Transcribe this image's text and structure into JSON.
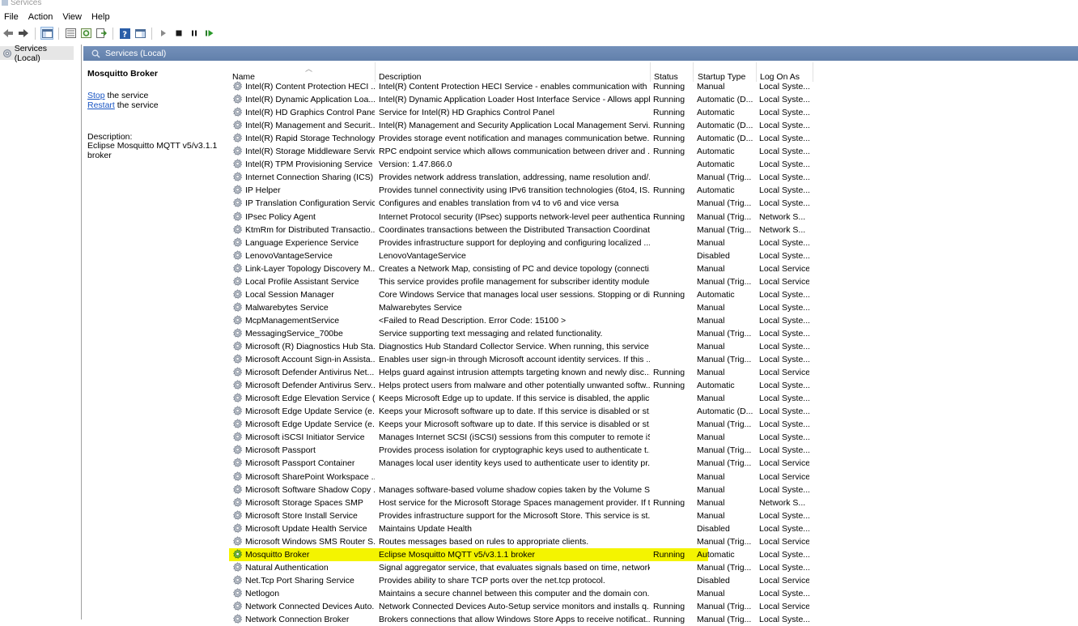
{
  "window": {
    "title": "Services"
  },
  "menu": [
    "File",
    "Action",
    "View",
    "Help"
  ],
  "tree": {
    "root": "Services (Local)"
  },
  "header": {
    "title": "Services (Local)"
  },
  "side": {
    "service_name": "Mosquitto Broker",
    "stop_link": "Stop",
    "stop_rest": " the service",
    "restart_link": "Restart",
    "restart_rest": " the service",
    "desc_label": "Description:",
    "desc_text": "Eclipse Mosquitto MQTT v5/v3.1.1 broker"
  },
  "columns": [
    "Name",
    "Description",
    "Status",
    "Startup Type",
    "Log On As"
  ],
  "selected_index": 36,
  "services": [
    [
      "Intel(R) Content Protection HECI ...",
      "Intel(R) Content Protection HECI Service - enables communication with ...",
      "Running",
      "Manual",
      "Local Syste..."
    ],
    [
      "Intel(R) Dynamic Application Loa...",
      "Intel(R) Dynamic Application Loader Host Interface Service - Allows appl...",
      "Running",
      "Automatic (D...",
      "Local Syste..."
    ],
    [
      "Intel(R) HD Graphics Control Pane...",
      "Service for Intel(R) HD Graphics Control Panel",
      "Running",
      "Automatic",
      "Local Syste..."
    ],
    [
      "Intel(R) Management and Securit...",
      "Intel(R) Management and Security Application Local Management Servi...",
      "Running",
      "Automatic (D...",
      "Local Syste..."
    ],
    [
      "Intel(R) Rapid Storage Technology",
      "Provides storage event notification and manages communication betwe...",
      "Running",
      "Automatic (D...",
      "Local Syste..."
    ],
    [
      "Intel(R) Storage Middleware Service",
      "RPC endpoint service which allows communication between driver and ...",
      "Running",
      "Automatic",
      "Local Syste..."
    ],
    [
      "Intel(R) TPM Provisioning Service",
      "Version: 1.47.866.0",
      "",
      "Automatic",
      "Local Syste..."
    ],
    [
      "Internet Connection Sharing (ICS)",
      "Provides network address translation, addressing, name resolution and/...",
      "",
      "Manual (Trig...",
      "Local Syste..."
    ],
    [
      "IP Helper",
      "Provides tunnel connectivity using IPv6 transition technologies (6to4, IS...",
      "Running",
      "Automatic",
      "Local Syste..."
    ],
    [
      "IP Translation Configuration Service",
      "Configures and enables translation from v4 to v6 and vice versa",
      "",
      "Manual (Trig...",
      "Local Syste..."
    ],
    [
      "IPsec Policy Agent",
      "Internet Protocol security (IPsec) supports network-level peer authentica...",
      "Running",
      "Manual (Trig...",
      "Network S..."
    ],
    [
      "KtmRm for Distributed Transactio...",
      "Coordinates transactions between the Distributed Transaction Coordinat...",
      "",
      "Manual (Trig...",
      "Network S..."
    ],
    [
      "Language Experience Service",
      "Provides infrastructure support for deploying and configuring localized ...",
      "",
      "Manual",
      "Local Syste..."
    ],
    [
      "LenovoVantageService",
      "LenovoVantageService",
      "",
      "Disabled",
      "Local Syste..."
    ],
    [
      "Link-Layer Topology Discovery M...",
      "Creates a Network Map, consisting of PC and device topology (connecti...",
      "",
      "Manual",
      "Local Service"
    ],
    [
      "Local Profile Assistant Service",
      "This service provides profile management for subscriber identity modules",
      "",
      "Manual (Trig...",
      "Local Service"
    ],
    [
      "Local Session Manager",
      "Core Windows Service that manages local user sessions. Stopping or dis...",
      "Running",
      "Automatic",
      "Local Syste..."
    ],
    [
      "Malwarebytes Service",
      "Malwarebytes Service",
      "",
      "Manual",
      "Local Syste..."
    ],
    [
      "McpManagementService",
      "<Failed to Read Description. Error Code: 15100 >",
      "",
      "Manual",
      "Local Syste..."
    ],
    [
      "MessagingService_700be",
      "Service supporting text messaging and related functionality.",
      "",
      "Manual (Trig...",
      "Local Syste..."
    ],
    [
      "Microsoft (R) Diagnostics Hub Sta...",
      "Diagnostics Hub Standard Collector Service. When running, this service ...",
      "",
      "Manual",
      "Local Syste..."
    ],
    [
      "Microsoft Account Sign-in Assista...",
      "Enables user sign-in through Microsoft account identity services. If this ...",
      "",
      "Manual (Trig...",
      "Local Syste..."
    ],
    [
      "Microsoft Defender Antivirus Net...",
      "Helps guard against intrusion attempts targeting known and newly disc...",
      "Running",
      "Manual",
      "Local Service"
    ],
    [
      "Microsoft Defender Antivirus Serv...",
      "Helps protect users from malware and other potentially unwanted softw...",
      "Running",
      "Automatic",
      "Local Syste..."
    ],
    [
      "Microsoft Edge Elevation Service (...",
      "Keeps Microsoft Edge up to update. If this service is disabled, the applic...",
      "",
      "Manual",
      "Local Syste..."
    ],
    [
      "Microsoft Edge Update Service (e...",
      "Keeps your Microsoft software up to date. If this service is disabled or st...",
      "",
      "Automatic (D...",
      "Local Syste..."
    ],
    [
      "Microsoft Edge Update Service (e...",
      "Keeps your Microsoft software up to date. If this service is disabled or st...",
      "",
      "Manual (Trig...",
      "Local Syste..."
    ],
    [
      "Microsoft iSCSI Initiator Service",
      "Manages Internet SCSI (iSCSI) sessions from this computer to remote iS...",
      "",
      "Manual",
      "Local Syste..."
    ],
    [
      "Microsoft Passport",
      "Provides process isolation for cryptographic keys used to authenticate t...",
      "",
      "Manual (Trig...",
      "Local Syste..."
    ],
    [
      "Microsoft Passport Container",
      "Manages local user identity keys used to authenticate user to identity pr...",
      "",
      "Manual (Trig...",
      "Local Service"
    ],
    [
      "Microsoft SharePoint Workspace ...",
      "",
      "",
      "Manual",
      "Local Service"
    ],
    [
      "Microsoft Software Shadow Copy ...",
      "Manages software-based volume shadow copies taken by the Volume S...",
      "",
      "Manual",
      "Local Syste..."
    ],
    [
      "Microsoft Storage Spaces SMP",
      "Host service for the Microsoft Storage Spaces management provider. If t...",
      "Running",
      "Manual",
      "Network S..."
    ],
    [
      "Microsoft Store Install Service",
      "Provides infrastructure support for the Microsoft Store.  This service is st...",
      "",
      "Manual",
      "Local Syste..."
    ],
    [
      "Microsoft Update Health Service",
      "Maintains Update Health",
      "",
      "Disabled",
      "Local Syste..."
    ],
    [
      "Microsoft Windows SMS Router S...",
      "Routes messages based on rules to appropriate clients.",
      "",
      "Manual (Trig...",
      "Local Service"
    ],
    [
      "Mosquitto Broker",
      "Eclipse Mosquitto MQTT v5/v3.1.1 broker",
      "Running",
      "Automatic",
      "Local Syste..."
    ],
    [
      "Natural Authentication",
      "Signal aggregator service, that evaluates signals based on time, network,...",
      "",
      "Manual (Trig...",
      "Local Syste..."
    ],
    [
      "Net.Tcp Port Sharing Service",
      "Provides ability to share TCP ports over the net.tcp protocol.",
      "",
      "Disabled",
      "Local Service"
    ],
    [
      "Netlogon",
      "Maintains a secure channel between this computer and the domain con...",
      "",
      "Manual",
      "Local Syste..."
    ],
    [
      "Network Connected Devices Auto...",
      "Network Connected Devices Auto-Setup service monitors and installs q...",
      "Running",
      "Manual (Trig...",
      "Local Service"
    ],
    [
      "Network Connection Broker",
      "Brokers connections that allow Windows Store Apps to receive notificat...",
      "Running",
      "Manual (Trig...",
      "Local Syste..."
    ]
  ]
}
